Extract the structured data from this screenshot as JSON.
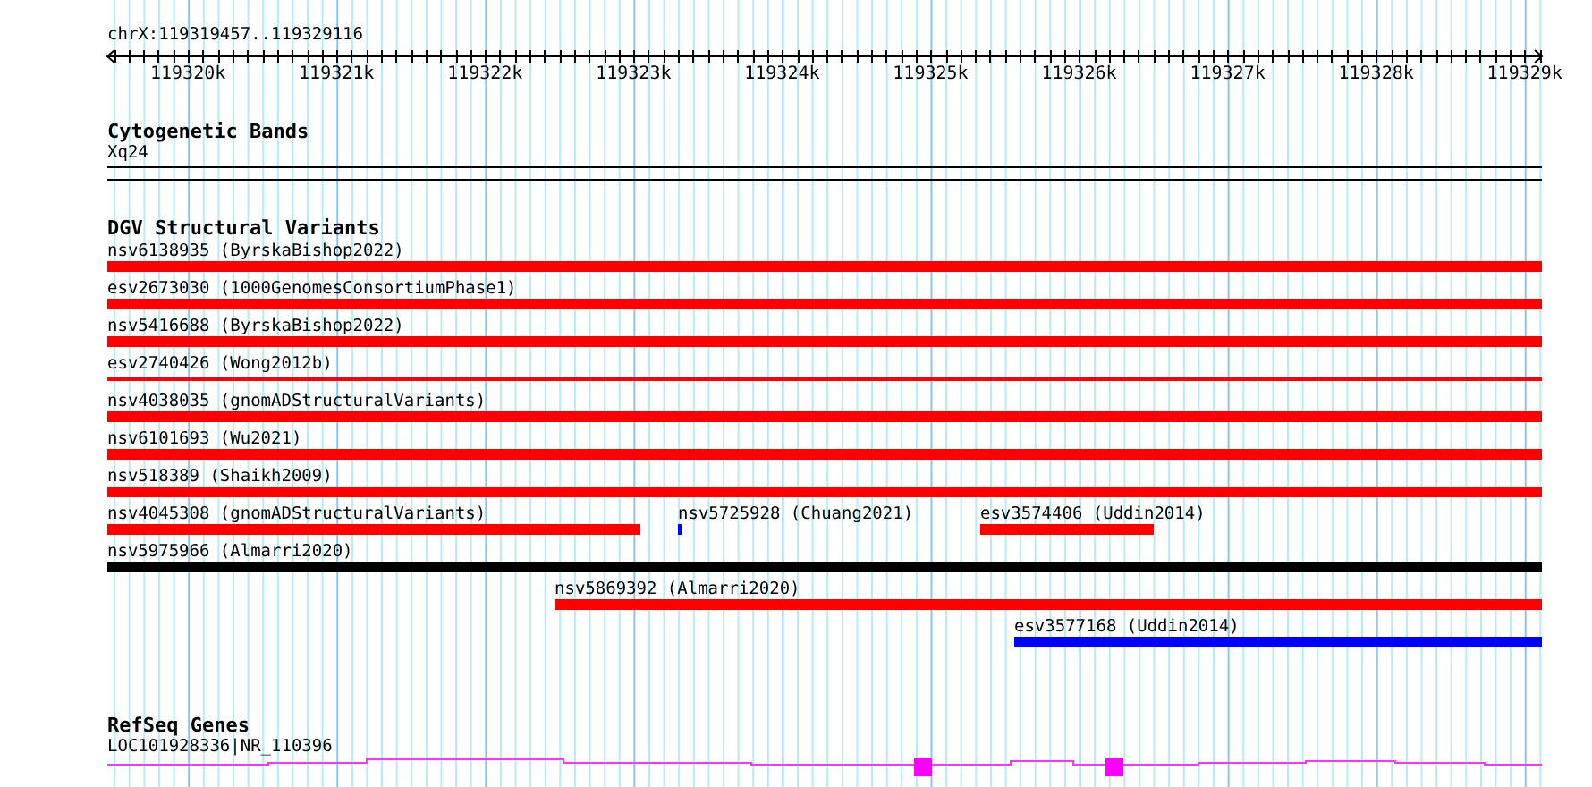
{
  "ruler": {
    "location": "chrX:119319457..119329116",
    "ticks": [
      "119320k",
      "119321k",
      "119322k",
      "119323k",
      "119324k",
      "119325k",
      "119326k",
      "119327k",
      "119328k",
      "119329k"
    ]
  },
  "cytoband_track": {
    "title": "Cytogenetic Bands",
    "band": "Xq24"
  },
  "variant_track": {
    "title": "DGV Structural Variants",
    "lanes": [
      {
        "features": [
          {
            "label": "nsv6138935 (ByrskaBishop2022)",
            "kind": "bar",
            "color": "#ff0000"
          }
        ]
      },
      {
        "features": [
          {
            "label": "esv2673030 (1000GenomesConsortiumPhase1)",
            "kind": "bar",
            "color": "#ff0000"
          }
        ]
      },
      {
        "features": [
          {
            "label": "nsv5416688 (ByrskaBishop2022)",
            "kind": "bar",
            "color": "#ff0000"
          }
        ]
      },
      {
        "features": [
          {
            "label": "esv2740426 (Wong2012b)",
            "kind": "line",
            "color": "#ff0000"
          }
        ]
      },
      {
        "features": [
          {
            "label": "nsv4038035 (gnomADStructuralVariants)",
            "kind": "bar",
            "color": "#ff0000"
          }
        ]
      },
      {
        "features": [
          {
            "label": "nsv6101693 (Wu2021)",
            "kind": "bar",
            "color": "#ff0000"
          }
        ]
      },
      {
        "features": [
          {
            "label": "nsv518389 (Shaikh2009)",
            "kind": "bar",
            "color": "#ff0000"
          }
        ]
      },
      {
        "features": [
          {
            "label": "nsv4045308 (gnomADStructuralVariants)",
            "kind": "bar",
            "color": "#ff0000"
          },
          {
            "label": "nsv5725928 (Chuang2021)",
            "kind": "bar",
            "color": "#0000ff"
          },
          {
            "label": "esv3574406 (Uddin2014)",
            "kind": "bar",
            "color": "#ff0000"
          }
        ]
      },
      {
        "features": [
          {
            "label": "nsv5975966 (Almarri2020)",
            "kind": "bar",
            "color": "#000000"
          }
        ]
      },
      {
        "features": [
          {
            "label": "nsv5869392 (Almarri2020)",
            "kind": "bar",
            "color": "#ff0000"
          }
        ]
      },
      {
        "features": [
          {
            "label": "esv3577168 (Uddin2014)",
            "kind": "bar",
            "color": "#0000ff"
          }
        ]
      }
    ]
  },
  "gene_track": {
    "title": "RefSeq Genes",
    "gene": "LOC101928336|NR_110396"
  }
}
